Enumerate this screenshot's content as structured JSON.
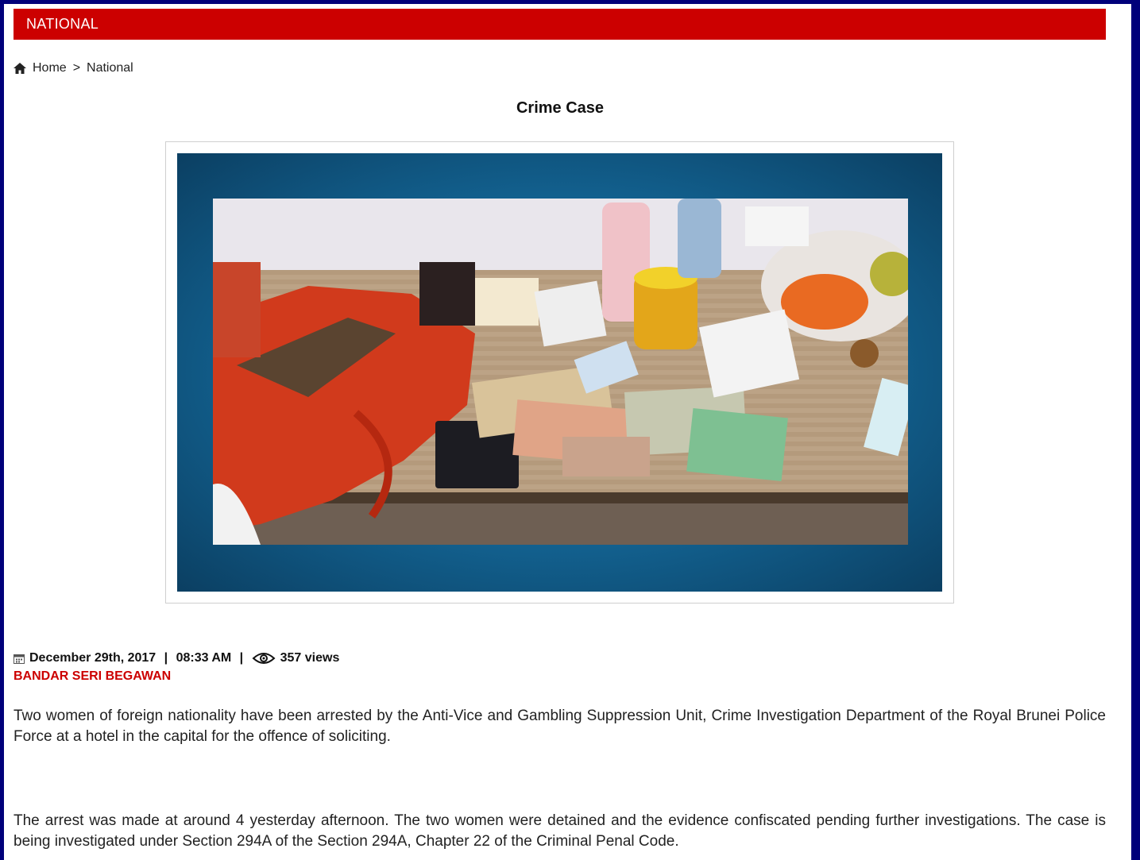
{
  "section": {
    "label": "NATIONAL"
  },
  "breadcrumb": {
    "home": "Home",
    "separator": ">",
    "current": "National"
  },
  "article": {
    "title": "Crime Case",
    "date": "December 29th, 2017",
    "time": "08:33 AM",
    "views": "357 views",
    "location": "BANDAR SERI BEGAWAN",
    "paragraphs": [
      "Two women of foreign nationality have been arrested by the Anti-Vice and Gambling Suppression Unit, Crime Investigation Department of the Royal Brunei Police Force at a hotel in the capital for the offence of soliciting.",
      "The arrest was made at around 4 yesterday afternoon. The two women were detained and the evidence confiscated pending further investigations. The case is being investigated under Section 294A of the Section 294A, Chapter 22 of the Criminal Penal Code."
    ]
  },
  "colors": {
    "accent": "#cc0000",
    "frame": "#00007a"
  },
  "icons": {
    "home": "home-icon",
    "calendar": "calendar-icon",
    "views": "eye-icon"
  }
}
